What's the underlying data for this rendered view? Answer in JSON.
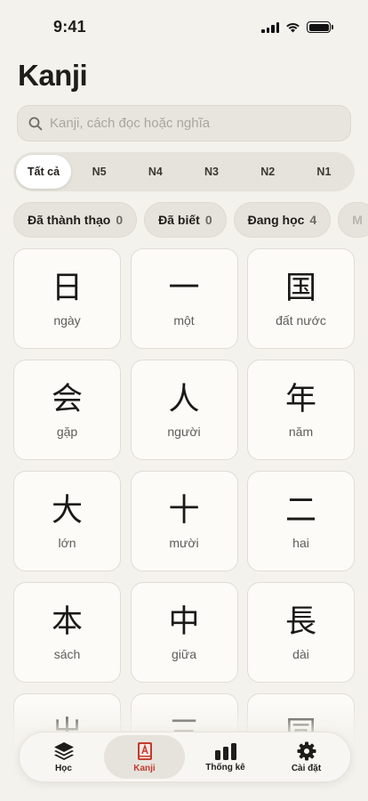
{
  "status": {
    "time": "9:41"
  },
  "title": "Kanji",
  "search": {
    "placeholder": "Kanji, cách đọc hoặc nghĩa",
    "value": ""
  },
  "levels": [
    "Tất cả",
    "N5",
    "N4",
    "N3",
    "N2",
    "N1"
  ],
  "active_level": "Tất cả",
  "filters": [
    {
      "label": "Đã thành thạo",
      "count": "0"
    },
    {
      "label": "Đã biết",
      "count": "0"
    },
    {
      "label": "Đang học",
      "count": "4"
    },
    {
      "label": "M",
      "count": ""
    }
  ],
  "cards": [
    {
      "kanji": "日",
      "meaning": "ngày"
    },
    {
      "kanji": "一",
      "meaning": "một"
    },
    {
      "kanji": "国",
      "meaning": "đất nước"
    },
    {
      "kanji": "会",
      "meaning": "gặp"
    },
    {
      "kanji": "人",
      "meaning": "người"
    },
    {
      "kanji": "年",
      "meaning": "năm"
    },
    {
      "kanji": "大",
      "meaning": "lớn"
    },
    {
      "kanji": "十",
      "meaning": "mười"
    },
    {
      "kanji": "二",
      "meaning": "hai"
    },
    {
      "kanji": "本",
      "meaning": "sách"
    },
    {
      "kanji": "中",
      "meaning": "giữa"
    },
    {
      "kanji": "長",
      "meaning": "dài"
    },
    {
      "kanji": "出",
      "meaning": ""
    },
    {
      "kanji": "三",
      "meaning": ""
    },
    {
      "kanji": "同",
      "meaning": ""
    }
  ],
  "tabbar": [
    {
      "label": "Học",
      "icon": "layers-icon"
    },
    {
      "label": "Kanji",
      "icon": "kanji-book-icon"
    },
    {
      "label": "Thống kê",
      "icon": "bar-chart-icon"
    },
    {
      "label": "Cài đặt",
      "icon": "gear-icon"
    }
  ],
  "active_tab": "Kanji",
  "colors": {
    "accent": "#c43a2c",
    "background": "#f4f2ec",
    "card": "#fcfbf8"
  }
}
